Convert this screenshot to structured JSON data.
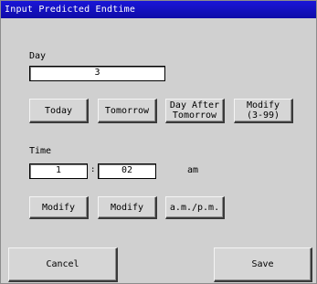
{
  "window": {
    "title": "Input Predicted Endtime"
  },
  "day": {
    "label": "Day",
    "value": "3",
    "buttons": {
      "today": "Today",
      "tomorrow": "Tomorrow",
      "day_after_tomorrow": "Day After\nTomorrow",
      "modify": "Modify\n(3-99)"
    }
  },
  "time": {
    "label": "Time",
    "hour": "1",
    "separator": ":",
    "minute": "02",
    "ampm": "am",
    "buttons": {
      "modify_hour": "Modify",
      "modify_minute": "Modify",
      "ampm_toggle": "a.m./p.m."
    }
  },
  "footer": {
    "cancel_label": "Cancel",
    "save_label": "Save"
  },
  "colors": {
    "titlebar": "#1a16d8",
    "window_bg": "#d0d0d0",
    "field_bg": "#ffffff"
  }
}
